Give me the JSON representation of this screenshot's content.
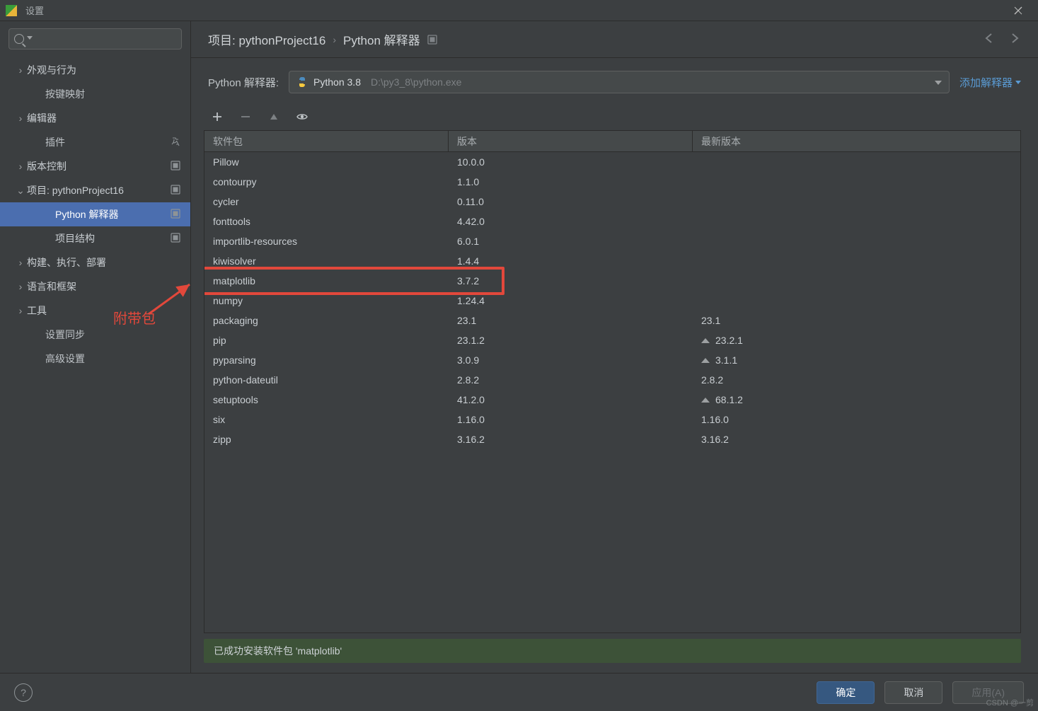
{
  "window": {
    "title": "设置"
  },
  "sidebar": {
    "search_placeholder": "",
    "items": [
      {
        "label": "外观与行为",
        "expandable": true,
        "chev": "›"
      },
      {
        "label": "按键映射",
        "expandable": false,
        "level": 2
      },
      {
        "label": "编辑器",
        "expandable": true,
        "chev": "›"
      },
      {
        "label": "插件",
        "expandable": false,
        "level": 2,
        "right": "lang"
      },
      {
        "label": "版本控制",
        "expandable": true,
        "chev": "›",
        "right": "box"
      },
      {
        "label": "项目: pythonProject16",
        "expandable": true,
        "chev": "⌄",
        "right": "box"
      },
      {
        "label": "Python 解释器",
        "expandable": false,
        "level": 3,
        "selected": true,
        "right": "box"
      },
      {
        "label": "项目结构",
        "expandable": false,
        "level": 3,
        "right": "box"
      },
      {
        "label": "构建、执行、部署",
        "expandable": true,
        "chev": "›"
      },
      {
        "label": "语言和框架",
        "expandable": true,
        "chev": "›"
      },
      {
        "label": "工具",
        "expandable": true,
        "chev": "›"
      },
      {
        "label": "设置同步",
        "expandable": false,
        "level": 2
      },
      {
        "label": "高级设置",
        "expandable": false,
        "level": 2
      }
    ],
    "annotation": "附带包"
  },
  "breadcrumb": {
    "item1": "项目: pythonProject16",
    "item2": "Python 解释器"
  },
  "interpreter": {
    "label": "Python 解释器:",
    "name": "Python 3.8",
    "path": "D:\\py3_8\\python.exe",
    "add_label": "添加解释器"
  },
  "pkg_table": {
    "headers": {
      "c1": "软件包",
      "c2": "版本",
      "c3": "最新版本"
    },
    "rows": [
      {
        "name": "Pillow",
        "version": "10.0.0",
        "latest": ""
      },
      {
        "name": "contourpy",
        "version": "1.1.0",
        "latest": ""
      },
      {
        "name": "cycler",
        "version": "0.11.0",
        "latest": ""
      },
      {
        "name": "fonttools",
        "version": "4.42.0",
        "latest": ""
      },
      {
        "name": "importlib-resources",
        "version": "6.0.1",
        "latest": ""
      },
      {
        "name": "kiwisolver",
        "version": "1.4.4",
        "latest": ""
      },
      {
        "name": "matplotlib",
        "version": "3.7.2",
        "latest": "",
        "highlight": true
      },
      {
        "name": "numpy",
        "version": "1.24.4",
        "latest": ""
      },
      {
        "name": "packaging",
        "version": "23.1",
        "latest": "23.1"
      },
      {
        "name": "pip",
        "version": "23.1.2",
        "latest": "23.2.1",
        "upgrade": true
      },
      {
        "name": "pyparsing",
        "version": "3.0.9",
        "latest": "3.1.1",
        "upgrade": true
      },
      {
        "name": "python-dateutil",
        "version": "2.8.2",
        "latest": "2.8.2"
      },
      {
        "name": "setuptools",
        "version": "41.2.0",
        "latest": "68.1.2",
        "upgrade": true
      },
      {
        "name": "six",
        "version": "1.16.0",
        "latest": "1.16.0"
      },
      {
        "name": "zipp",
        "version": "3.16.2",
        "latest": "3.16.2"
      }
    ]
  },
  "status": "已成功安装软件包 'matplotlib'",
  "footer": {
    "ok": "确定",
    "cancel": "取消",
    "apply": "应用(A)"
  },
  "watermark": "CSDN @一剪"
}
